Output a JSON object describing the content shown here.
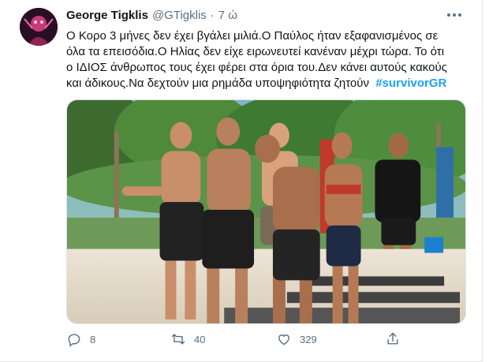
{
  "tweet": {
    "author_name": "George Tigklis",
    "author_handle": "@GTigklis",
    "separator": "·",
    "time": "7 ώ",
    "text_lines": [
      "Ο Κορο 3 μήνες δεν έχει βγάλει μιλιά.Ο Παύλος ήταν εξαφανισμένος σε",
      "όλα τα επεισόδια.Ο Ηλίας δεν είχε ειρωνευτεί κανέναν μέχρι τώρα. Το ότι",
      "ο ΙΔΙΟΣ άνθρωπος τους έχει φέρει στα όρια του.Δεν κάνει αυτούς κακούς",
      "και άδικους.Να δεχτούν μια ρημάδα υποψηφιότητα ζητούν"
    ],
    "hashtag": "#survivorGR",
    "icons": {
      "more": "more-options-icon",
      "reply": "reply-icon",
      "retweet": "retweet-icon",
      "like": "like-icon",
      "share": "share-icon"
    },
    "stats": {
      "replies": "8",
      "retweets": "40",
      "likes": "329"
    },
    "colors": {
      "hashtag": "#1da1f2",
      "secondary_text": "#5b7083"
    }
  }
}
